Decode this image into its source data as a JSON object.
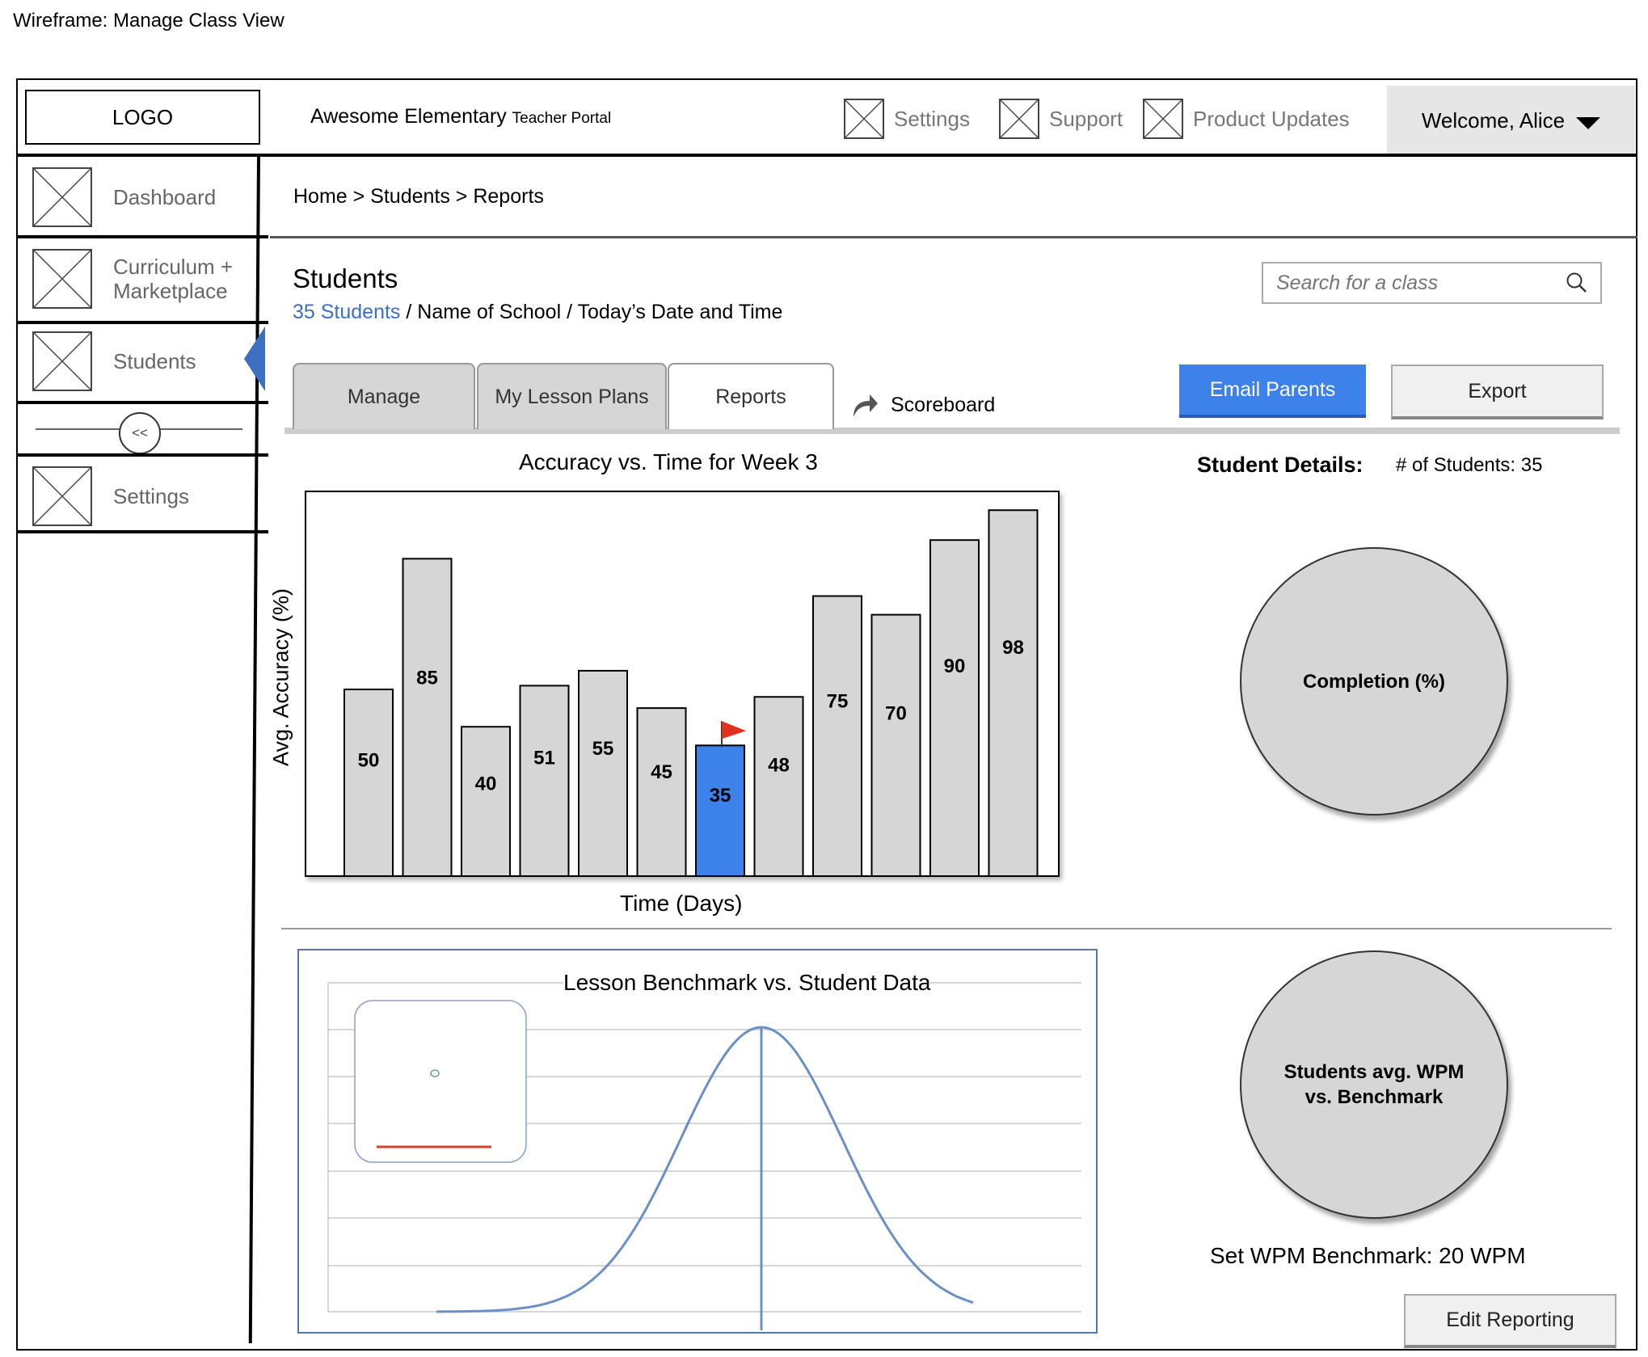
{
  "wireframe_title": "Wireframe: Manage Class View",
  "header": {
    "logo": "LOGO",
    "school": "Awesome Elementary",
    "portal": "Teacher Portal",
    "nav": [
      {
        "label": "Settings",
        "icon": "placeholder-image-icon"
      },
      {
        "label": "Support",
        "icon": "placeholder-image-icon"
      },
      {
        "label": "Product Updates",
        "icon": "placeholder-image-icon"
      }
    ],
    "welcome": "Welcome, Alice"
  },
  "sidebar": {
    "items": [
      {
        "label": "Dashboard"
      },
      {
        "label_line1": "Curriculum +",
        "label_line2": "Marketplace"
      },
      {
        "label": "Students",
        "active": true
      },
      {
        "label": "Settings"
      }
    ],
    "collapse": "<<"
  },
  "breadcrumb": "Home > Students > Reports",
  "page": {
    "title": "Students",
    "student_count_link": "35 Students",
    "meta": " / Name of School / Today’s Date and Time"
  },
  "search": {
    "placeholder": "Search for a class"
  },
  "tabs": [
    {
      "label": "Manage",
      "active": false
    },
    {
      "label": "My Lesson Plans",
      "active": false
    },
    {
      "label": "Reports",
      "active": true
    }
  ],
  "scoreboard": "Scoreboard",
  "buttons": {
    "email_parents": "Email Parents",
    "export": "Export",
    "edit_reporting": "Edit Reporting"
  },
  "colors": {
    "accent": "#3d82ea",
    "link": "#3d6fc3",
    "bar": "#d6d6d6",
    "highlight": "#3d82ea",
    "flag": "#e0301e",
    "curve": "#6b8fc7"
  },
  "chart_data": [
    {
      "type": "bar",
      "title": "Accuracy vs. Time for Week 3",
      "xlabel": "Time (Days)",
      "ylabel": "Avg. Accuracy (%)",
      "values": [
        50,
        85,
        40,
        51,
        55,
        45,
        35,
        48,
        75,
        70,
        90,
        98
      ],
      "highlight_index": 6,
      "ylim": [
        0,
        100
      ]
    },
    {
      "type": "line",
      "title": "Lesson Benchmark vs. Student Data",
      "shape": "normal distribution curve with vertical line at peak",
      "grid": true
    }
  ],
  "details": {
    "title": "Student Details:",
    "count": "# of Students: 35",
    "completion": "Completion (%)",
    "wpm_line1": "Students avg. WPM",
    "wpm_line2": "vs. Benchmark",
    "benchmark_label": "Set WPM Benchmark: 20 WPM"
  }
}
